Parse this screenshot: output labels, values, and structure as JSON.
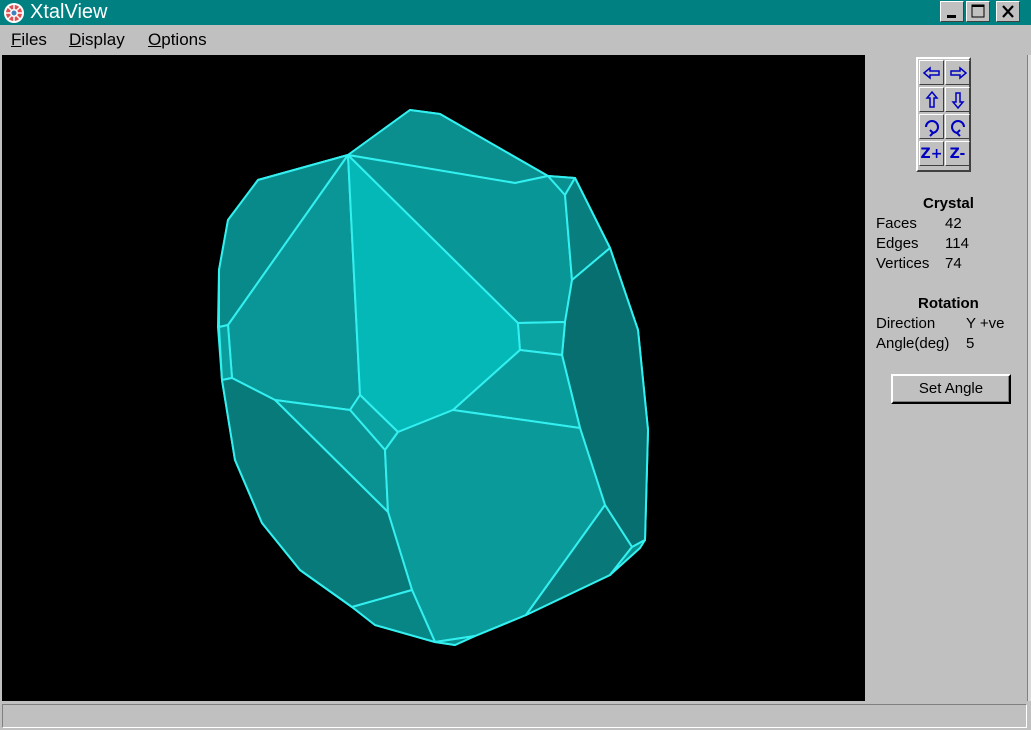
{
  "window": {
    "title": "XtalView",
    "app_icon": "crystal-wheel-icon",
    "controls": [
      "minimize-icon",
      "maximize-icon",
      "close-icon"
    ]
  },
  "menu": {
    "files": "Files",
    "display": "Display",
    "options": "Options"
  },
  "toolbar": {
    "buttons": [
      {
        "icon": "rotate-left-icon"
      },
      {
        "icon": "rotate-right-icon"
      },
      {
        "icon": "rotate-up-icon"
      },
      {
        "icon": "rotate-down-icon"
      },
      {
        "icon": "spin-clockwise-icon"
      },
      {
        "icon": "spin-counterclockwise-icon"
      },
      {
        "icon": "zoom-in-icon",
        "label": "Z+"
      },
      {
        "icon": "zoom-out-icon",
        "label": "Z-"
      }
    ]
  },
  "crystal": {
    "heading": "Crystal",
    "faces_label": "Faces",
    "faces_value": "42",
    "edges_label": "Edges",
    "edges_value": "114",
    "vertices_label": "Vertices",
    "vertices_value": "74"
  },
  "rotation": {
    "heading": "Rotation",
    "direction_label": "Direction",
    "direction_value": "Y +ve",
    "angle_label": "Angle(deg)",
    "angle_value": "5",
    "set_angle_button": "Set Angle"
  },
  "colors": {
    "titlebar": "#008080",
    "viewport_background": "#000000",
    "crystal_edges": "#33f0f0",
    "face_light": "#05b8b8",
    "face_mid": "#089c9c",
    "face_dark": "#077a7a",
    "window_gray": "#c0c0c0"
  }
}
